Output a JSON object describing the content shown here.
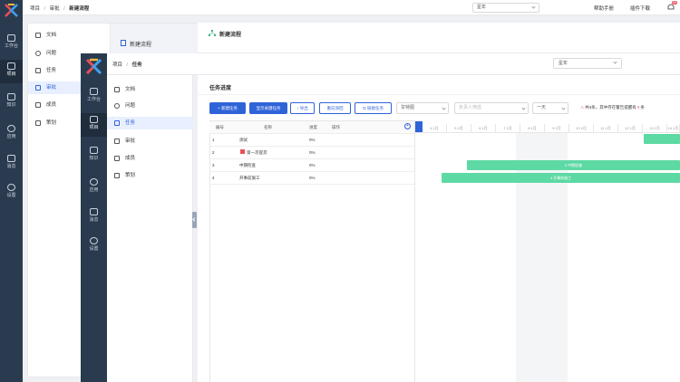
{
  "back": {
    "breadcrumb": [
      "项目",
      "审批",
      "新建流程"
    ],
    "project_select": "星年",
    "help_label": "帮助手册",
    "download_label": "插件下载",
    "badge_count": "99",
    "rail": [
      "工作台",
      "项目",
      "知识",
      "应用",
      "消息",
      "设置"
    ],
    "sidebar": [
      "文档",
      "问题",
      "任务",
      "审批",
      "成员",
      "策划"
    ],
    "tab_label": "新建流程",
    "page_title": "新建流程"
  },
  "front": {
    "breadcrumb": [
      "项目",
      "任务"
    ],
    "project_select": "星年",
    "rail": [
      "工作台",
      "项目",
      "知识",
      "应用",
      "消息",
      "设置"
    ],
    "sidebar": [
      "文档",
      "问题",
      "任务",
      "审批",
      "成员",
      "策划"
    ],
    "section_title": "任务进度",
    "toolbar": {
      "new_task": "新建任务",
      "show_critical": "显示关键任务",
      "export": "导出",
      "batch_delete": "重向添回",
      "link_task": "链接任务",
      "view_select": "甘特图",
      "owner_placeholder": "负责人筛选",
      "range_select": "一天",
      "notice_prefix": "共4条，其中存在警告提醒有",
      "notice_count": "0",
      "notice_suffix": "条"
    },
    "table": {
      "headers": [
        "编号",
        "名称",
        "进度",
        "操作"
      ],
      "rows": [
        {
          "id": "1",
          "name": "测试",
          "progress": "0%"
        },
        {
          "id": "2",
          "name": "第一次提货",
          "progress": "0%"
        },
        {
          "id": "3",
          "name": "中期检查",
          "progress": "0%"
        },
        {
          "id": "4",
          "name": "开事前施工",
          "progress": "0%"
        }
      ]
    },
    "gantt": {
      "months": [
        "4 1月",
        "5 1月",
        "6 1月",
        "7 1月",
        "8 1月",
        "9 1月",
        "10 1月",
        "11 1月",
        "12 1月",
        "13 1月",
        "14 1月"
      ],
      "bars": [
        {
          "label": "",
          "row": 1
        },
        {
          "label": "3 中期检查",
          "row": 3
        },
        {
          "label": "4 开事前施工",
          "row": 4
        }
      ]
    }
  }
}
